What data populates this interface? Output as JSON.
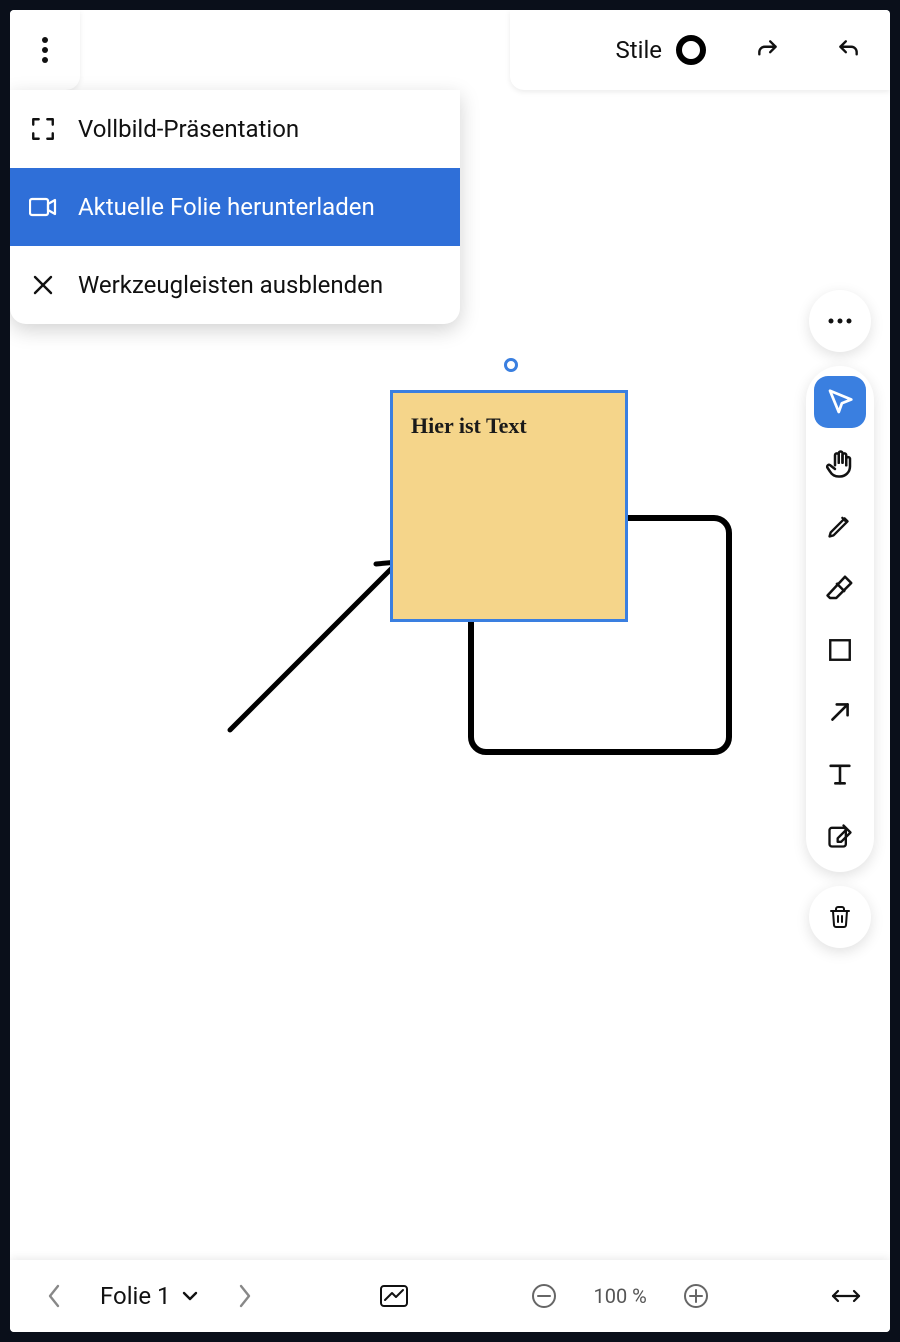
{
  "topbar": {
    "styles_label": "Stile"
  },
  "menu": {
    "items": [
      {
        "label": "Vollbild-Präsentation",
        "icon": "fullscreen-icon",
        "selected": false
      },
      {
        "label": "Aktuelle Folie herunterladen",
        "icon": "download-video-icon",
        "selected": true
      },
      {
        "label": "Werkzeugleisten ausblenden",
        "icon": "close-icon",
        "selected": false
      }
    ]
  },
  "canvas": {
    "sticky_text": "Hier ist Text"
  },
  "tools": {
    "items": [
      {
        "name": "select-tool",
        "icon": "cursor-icon",
        "active": true
      },
      {
        "name": "pan-tool",
        "icon": "hand-icon",
        "active": false
      },
      {
        "name": "pencil-tool",
        "icon": "pencil-icon",
        "active": false
      },
      {
        "name": "eraser-tool",
        "icon": "eraser-icon",
        "active": false
      },
      {
        "name": "shape-tool",
        "icon": "square-icon",
        "active": false
      },
      {
        "name": "arrow-tool",
        "icon": "arrow-icon",
        "active": false
      },
      {
        "name": "text-tool",
        "icon": "text-icon",
        "active": false
      },
      {
        "name": "note-tool",
        "icon": "note-edit-icon",
        "active": false
      }
    ]
  },
  "bottombar": {
    "slide_label": "Folie 1",
    "zoom_label": "100 %"
  }
}
